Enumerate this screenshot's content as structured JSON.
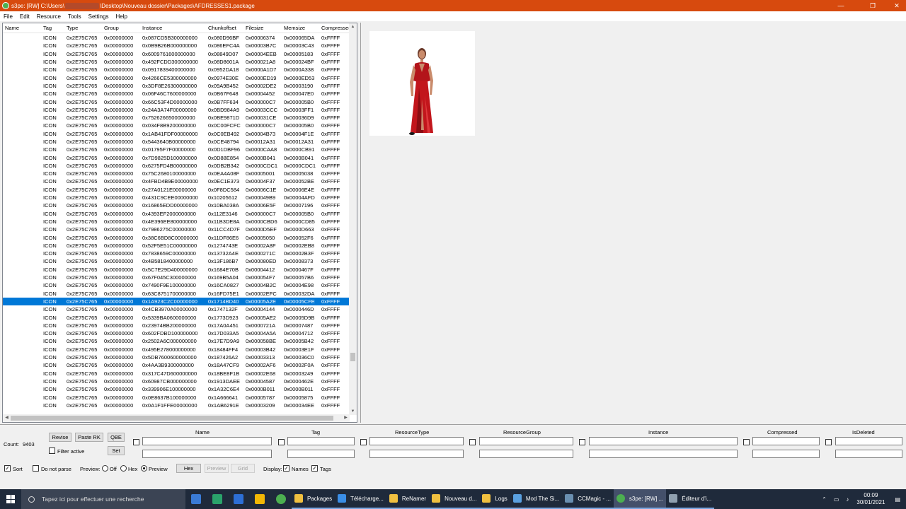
{
  "window": {
    "title_prefix": "s3pe: [RW] C:\\Users\\",
    "title_suffix": "\\Desktop\\Nouveau dossier\\Packages\\AFDRESSES1.package",
    "minimize": "—",
    "maximize": "❐",
    "close": "✕"
  },
  "menu": [
    "File",
    "Edit",
    "Resource",
    "Tools",
    "Settings",
    "Help"
  ],
  "columns": [
    "Name",
    "Tag",
    "Type",
    "Group",
    "Instance",
    "Chunkoffset",
    "Filesize",
    "Memsize",
    "Compressed"
  ],
  "rows": [
    [
      "",
      "ICON",
      "0x2E75C765",
      "0x00000000",
      "0x087CD5B300000000",
      "0x080D96BF",
      "0x00006374",
      "0x000065DA",
      "0xFFFF"
    ],
    [
      "",
      "ICON",
      "0x2E75C765",
      "0x00000000",
      "0x0B9B26B000000000",
      "0x086EFC4A",
      "0x00003B7C",
      "0x00003C43",
      "0xFFFF"
    ],
    [
      "",
      "ICON",
      "0x2E75C765",
      "0x00000000",
      "0x6009761600000000",
      "0x08849D07",
      "0x00004EEB",
      "0x00005183",
      "0xFFFF"
    ],
    [
      "",
      "ICON",
      "0x2E75C765",
      "0x00000000",
      "0x492FCDD300000000",
      "0x08D8601A",
      "0x000021A8",
      "0x000024BF",
      "0xFFFF"
    ],
    [
      "",
      "ICON",
      "0x2E75C765",
      "0x00000000",
      "0x0917839400000000",
      "0x0952DA18",
      "0x0000A1D7",
      "0x0000A338",
      "0xFFFF"
    ],
    [
      "",
      "ICON",
      "0x2E75C765",
      "0x00000000",
      "0x4266CE5300000000",
      "0x0974E30E",
      "0x0000ED19",
      "0x0000ED53",
      "0xFFFF"
    ],
    [
      "",
      "ICON",
      "0x2E75C765",
      "0x00000000",
      "0x3DF8E26300000000",
      "0x09A9B452",
      "0x00002DE2",
      "0x00003190",
      "0xFFFF"
    ],
    [
      "",
      "ICON",
      "0x2E75C765",
      "0x00000000",
      "0x06F46C7600000000",
      "0x0B67F648",
      "0x00004452",
      "0x000047E0",
      "0xFFFF"
    ],
    [
      "",
      "ICON",
      "0x2E75C765",
      "0x00000000",
      "0x66C53F4D00000000",
      "0x0B7FF634",
      "0x000000C7",
      "0x000005B0",
      "0xFFFF"
    ],
    [
      "",
      "ICON",
      "0x2E75C765",
      "0x00000000",
      "0x24A3A74F00000000",
      "0x0BD984A9",
      "0x00003CCC",
      "0x00003FF1",
      "0xFFFF"
    ],
    [
      "",
      "ICON",
      "0x2E75C765",
      "0x00000000",
      "0x7526266500000000",
      "0x0BE9871D",
      "0x000031CE",
      "0x000036D9",
      "0xFFFF"
    ],
    [
      "",
      "ICON",
      "0x2E75C765",
      "0x00000000",
      "0x034F8B9200000000",
      "0x0C00FCFC",
      "0x000000C7",
      "0x000005B0",
      "0xFFFF"
    ],
    [
      "",
      "ICON",
      "0x2E75C765",
      "0x00000000",
      "0x1AB41FDF00000000",
      "0x0C0EB492",
      "0x00004B73",
      "0x00004F1E",
      "0xFFFF"
    ],
    [
      "",
      "ICON",
      "0x2E75C765",
      "0x00000000",
      "0x5443640B00000000",
      "0x0CE48794",
      "0x00012A31",
      "0x00012A31",
      "0xFFFF"
    ],
    [
      "",
      "ICON",
      "0x2E75C765",
      "0x00000000",
      "0x01795F7F00000000",
      "0x0D1DBF96",
      "0x0000CAA8",
      "0x0000CB91",
      "0xFFFF"
    ],
    [
      "",
      "ICON",
      "0x2E75C765",
      "0x00000000",
      "0x7D9825D100000000",
      "0x0D88E854",
      "0x0000B041",
      "0x0000B041",
      "0xFFFF"
    ],
    [
      "",
      "ICON",
      "0x2E75C765",
      "0x00000000",
      "0x6275FD4B00000000",
      "0x0DB2B342",
      "0x0000CDC1",
      "0x0000CDC1",
      "0xFFFF"
    ],
    [
      "",
      "ICON",
      "0x2E75C765",
      "0x00000000",
      "0x75C2680100000000",
      "0x0EA4A08F",
      "0x00005001",
      "0x00005038",
      "0xFFFF"
    ],
    [
      "",
      "ICON",
      "0x2E75C765",
      "0x00000000",
      "0x4FBD4B9E00000000",
      "0x0EC1E373",
      "0x00004F37",
      "0x000052BE",
      "0xFFFF"
    ],
    [
      "",
      "ICON",
      "0x2E75C765",
      "0x00000000",
      "0x27A0121E00000000",
      "0x0F8DC584",
      "0x00006C1E",
      "0x00006E4E",
      "0xFFFF"
    ],
    [
      "",
      "ICON",
      "0x2E75C765",
      "0x00000000",
      "0x431C9CEE00000000",
      "0x10205612",
      "0x000049B9",
      "0x00004AFD",
      "0xFFFF"
    ],
    [
      "",
      "ICON",
      "0x2E75C765",
      "0x00000000",
      "0x16865EDD00000000",
      "0x10BA038A",
      "0x00006E5F",
      "0x00007196",
      "0xFFFF"
    ],
    [
      "",
      "ICON",
      "0x2E75C765",
      "0x00000000",
      "0x4393EF2000000000",
      "0x112E3146",
      "0x000000C7",
      "0x000005B0",
      "0xFFFF"
    ],
    [
      "",
      "ICON",
      "0x2E75C765",
      "0x00000000",
      "0x4E396EE800000000",
      "0x11B3DE8A",
      "0x0000CBD6",
      "0x0000CD85",
      "0xFFFF"
    ],
    [
      "",
      "ICON",
      "0x2E75C765",
      "0x00000000",
      "0x7986275C00000000",
      "0x11CC4D7F",
      "0x0000D5EF",
      "0x0000D663",
      "0xFFFF"
    ],
    [
      "",
      "ICON",
      "0x2E75C765",
      "0x00000000",
      "0x38C6BD8C00000000",
      "0x11DF86E6",
      "0x00005050",
      "0x000052F6",
      "0xFFFF"
    ],
    [
      "",
      "ICON",
      "0x2E75C765",
      "0x00000000",
      "0x52F5E51C00000000",
      "0x1274743E",
      "0x00002A8F",
      "0x00002EB8",
      "0xFFFF"
    ],
    [
      "",
      "ICON",
      "0x2E75C765",
      "0x00000000",
      "0x7838659C00000000",
      "0x13732A4E",
      "0x0000271C",
      "0x00002B3F",
      "0xFFFF"
    ],
    [
      "",
      "ICON",
      "0x2E75C765",
      "0x00000000",
      "0x4B5818400000000",
      "0x13F186B7",
      "0x000080ED",
      "0x00008373",
      "0xFFFF"
    ],
    [
      "",
      "ICON",
      "0x2E75C765",
      "0x00000000",
      "0x5C7E29D400000000",
      "0x1684E70B",
      "0x00004412",
      "0x0000467F",
      "0xFFFF"
    ],
    [
      "",
      "ICON",
      "0x2E75C765",
      "0x00000000",
      "0x67F045C300000000",
      "0x169B5A04",
      "0x000054F7",
      "0x000057B6",
      "0xFFFF"
    ],
    [
      "",
      "ICON",
      "0x2E75C765",
      "0x00000000",
      "0x7490F9E100000000",
      "0x16CA0827",
      "0x00004B2C",
      "0x00004E98",
      "0xFFFF"
    ],
    [
      "",
      "ICON",
      "0x2E75C765",
      "0x00000000",
      "0x63C8751700000000",
      "0x16FD75E1",
      "0x00002EFC",
      "0x000032DA",
      "0xFFFF"
    ],
    [
      "",
      "ICON",
      "0x2E75C765",
      "0x00000000",
      "0x1A923C2C00000000",
      "0x1714BD40",
      "0x00005A2E",
      "0x00005CFE",
      "0xFFFF"
    ],
    [
      "",
      "ICON",
      "0x2E75C765",
      "0x00000000",
      "0x4CB3970A00000000",
      "0x1747132F",
      "0x00004144",
      "0x0000446D",
      "0xFFFF"
    ],
    [
      "",
      "ICON",
      "0x2E75C765",
      "0x00000000",
      "0x5339BA0600000000",
      "0x1773D923",
      "0x00005AE2",
      "0x00005D9B",
      "0xFFFF"
    ],
    [
      "",
      "ICON",
      "0x2E75C765",
      "0x00000000",
      "0x23974BB200000000",
      "0x17A0A451",
      "0x0000721A",
      "0x00007487",
      "0xFFFF"
    ],
    [
      "",
      "ICON",
      "0x2E75C765",
      "0x00000000",
      "0x602FDBD100000000",
      "0x17D033A5",
      "0x00004A5A",
      "0x00004712",
      "0xFFFF"
    ],
    [
      "",
      "ICON",
      "0x2E75C765",
      "0x00000000",
      "0x2502A6C000000000",
      "0x17E7D9A9",
      "0x000058BE",
      "0x00005B42",
      "0xFFFF"
    ],
    [
      "",
      "ICON",
      "0x2E75C765",
      "0x00000000",
      "0x495E278000000000",
      "0x18484FF4",
      "0x00003B42",
      "0x00003E1F",
      "0xFFFF"
    ],
    [
      "",
      "ICON",
      "0x2E75C765",
      "0x00000000",
      "0x5DB7600600000000",
      "0x187426A2",
      "0x00003313",
      "0x000036C0",
      "0xFFFF"
    ],
    [
      "",
      "ICON",
      "0x2E75C765",
      "0x00000000",
      "0x4AA3B9300000000",
      "0x18A47CF9",
      "0x00002AF6",
      "0x00002F0A",
      "0xFFFF"
    ],
    [
      "",
      "ICON",
      "0x2E75C765",
      "0x00000000",
      "0x317C47D600000000",
      "0x18BE8F1B",
      "0x00002E68",
      "0x00003249",
      "0xFFFF"
    ],
    [
      "",
      "ICON",
      "0x2E75C765",
      "0x00000000",
      "0x60987CB000000000",
      "0x1913DAEE",
      "0x00004587",
      "0x0000462E",
      "0xFFFF"
    ],
    [
      "",
      "ICON",
      "0x2E75C765",
      "0x00000000",
      "0x339906E100000000",
      "0x1A32C6E4",
      "0x0000B011",
      "0x0000B011",
      "0xFFFF"
    ],
    [
      "",
      "ICON",
      "0x2E75C765",
      "0x00000000",
      "0x0E8637B100000000",
      "0x1A666641",
      "0x00005787",
      "0x00005875",
      "0xFFFF"
    ],
    [
      "",
      "ICON",
      "0x2E75C765",
      "0x00000000",
      "0x0A1F1FFE00000000",
      "0x1AB6291E",
      "0x00003209",
      "0x000034EE",
      "0xFFFF"
    ]
  ],
  "selected_row": 33,
  "bottom": {
    "count_label": "Count:",
    "count_value": "9403",
    "revise": "Revise",
    "paste_rk": "Paste RK",
    "qbe": "QBE",
    "set": "Set",
    "filter_active": "Filter active",
    "filter_columns": [
      "Name",
      "Tag",
      "ResourceType",
      "ResourceGroup",
      "Instance",
      "Compressed",
      "IsDeleted"
    ],
    "sort": "Sort",
    "do_not_parse": "Do not parse",
    "preview_label": "Preview:",
    "off": "Off",
    "hex": "Hex",
    "preview": "Preview",
    "hex_button": "Hex",
    "preview_button": "Preview",
    "grid_button": "Grid",
    "display_label": "Display:",
    "names": "Names",
    "tags": "Tags"
  },
  "taskbar": {
    "search_placeholder": "Tapez ici pour effectuer une recherche",
    "tasks": [
      {
        "label": "Packages",
        "color": "#f0c040"
      },
      {
        "label": "Télécharge...",
        "color": "#3a8ee6"
      },
      {
        "label": "ReNamer",
        "color": "#f0c040"
      },
      {
        "label": "Nouveau d...",
        "color": "#f0c040"
      },
      {
        "label": "Logs",
        "color": "#f0c040"
      },
      {
        "label": "Mod The Si...",
        "color": "#5aa0e0"
      },
      {
        "label": "CCMagic - ...",
        "color": "#6a8fb0"
      },
      {
        "label": "s3pe: [RW] ...",
        "color": "#4caf50"
      },
      {
        "label": "Éditeur d'i...",
        "color": "#90a0b0"
      }
    ],
    "time": "00:09",
    "date": "30/01/2021"
  },
  "colors": {
    "titlebar": "#d74a0e",
    "selection": "#0078d7",
    "taskbar": "#1f2a3b"
  }
}
